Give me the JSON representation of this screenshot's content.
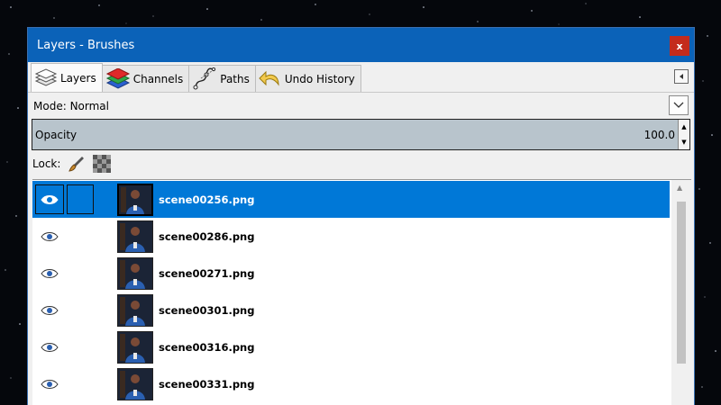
{
  "window": {
    "title": "Layers - Brushes",
    "close_label": "x",
    "accent_color": "#0b62b8"
  },
  "tabs": [
    {
      "label": "Layers",
      "icon": "layers-icon",
      "active": true
    },
    {
      "label": "Channels",
      "icon": "channels-icon",
      "active": false
    },
    {
      "label": "Paths",
      "icon": "paths-icon",
      "active": false
    },
    {
      "label": "Undo History",
      "icon": "undo-history-icon",
      "active": false
    }
  ],
  "mode": {
    "label": "Mode:",
    "value": "Normal"
  },
  "opacity": {
    "label": "Opacity",
    "value": "100.0"
  },
  "lock": {
    "label": "Lock:"
  },
  "layers": [
    {
      "name": "scene00256.png",
      "visible": true,
      "selected": true
    },
    {
      "name": "scene00286.png",
      "visible": true,
      "selected": false
    },
    {
      "name": "scene00271.png",
      "visible": true,
      "selected": false
    },
    {
      "name": "scene00301.png",
      "visible": true,
      "selected": false
    },
    {
      "name": "scene00316.png",
      "visible": true,
      "selected": false
    },
    {
      "name": "scene00331.png",
      "visible": true,
      "selected": false
    }
  ]
}
